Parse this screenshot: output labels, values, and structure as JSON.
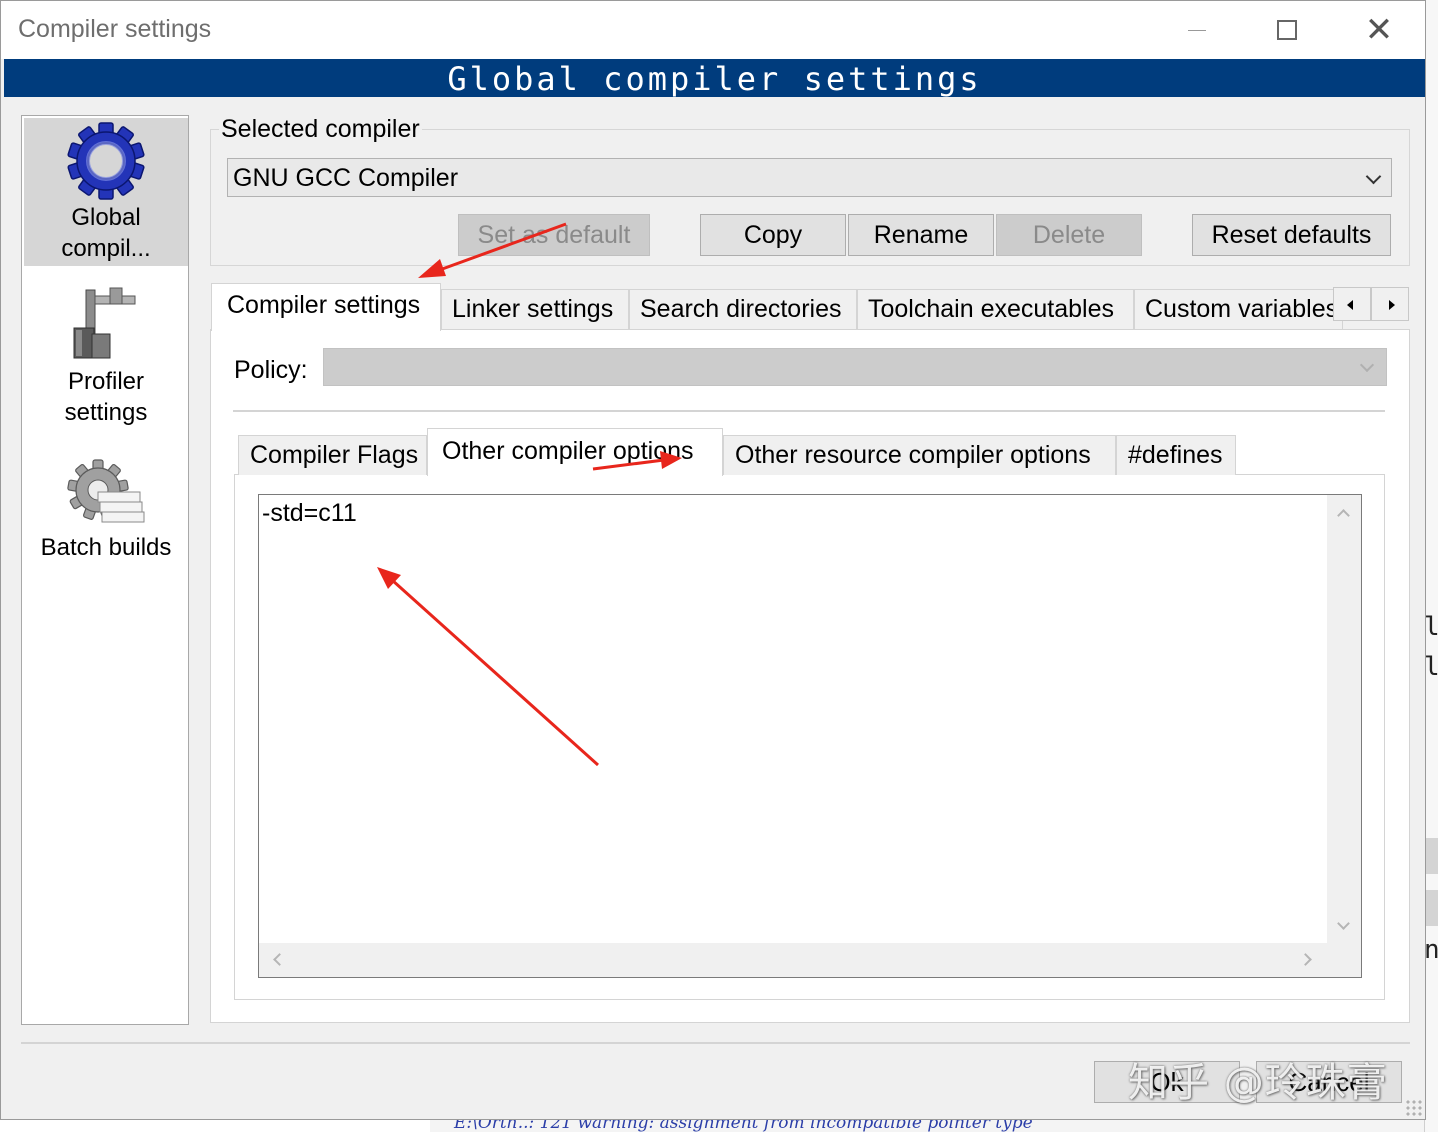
{
  "window": {
    "title": "Compiler settings"
  },
  "banner": {
    "title": "Global compiler settings"
  },
  "sidebar": {
    "items": [
      {
        "label_line1": "Global",
        "label_line2": "compil...",
        "icon": "gear-icon",
        "selected": true
      },
      {
        "label_line1": "Profiler",
        "label_line2": "settings",
        "icon": "profiler-caliper-icon",
        "selected": false
      },
      {
        "label_line1": "Batch builds",
        "icon": "batch-gear-icon",
        "selected": false
      }
    ]
  },
  "selected_compiler": {
    "label": "Selected compiler",
    "value": "GNU GCC Compiler",
    "buttons": {
      "set_default": "Set as default",
      "copy": "Copy",
      "rename": "Rename",
      "delete": "Delete",
      "reset_defaults": "Reset defaults"
    }
  },
  "tabs": [
    {
      "label": "Compiler settings",
      "active": true
    },
    {
      "label": "Linker settings",
      "active": false
    },
    {
      "label": "Search directories",
      "active": false
    },
    {
      "label": "Toolchain executables",
      "active": false
    },
    {
      "label": "Custom variables",
      "active": false
    }
  ],
  "policy": {
    "label": "Policy:",
    "value": ""
  },
  "inner_tabs": [
    {
      "label": "Compiler Flags",
      "active": false
    },
    {
      "label": "Other compiler options",
      "active": true
    },
    {
      "label": "Other resource compiler options",
      "active": false
    },
    {
      "label": "#defines",
      "active": false
    }
  ],
  "editor": {
    "content": "-std=c11"
  },
  "footer": {
    "ok": "Ok",
    "cancel": "Cancel"
  },
  "watermark": {
    "text": "知乎 @玲珠膏"
  },
  "background": {
    "log_line": "E:\\Orth..: 121 warning: assignment from incompatible pointer type"
  },
  "colors": {
    "banner": "#003c7d",
    "annotation_arrow": "#e8261c"
  }
}
